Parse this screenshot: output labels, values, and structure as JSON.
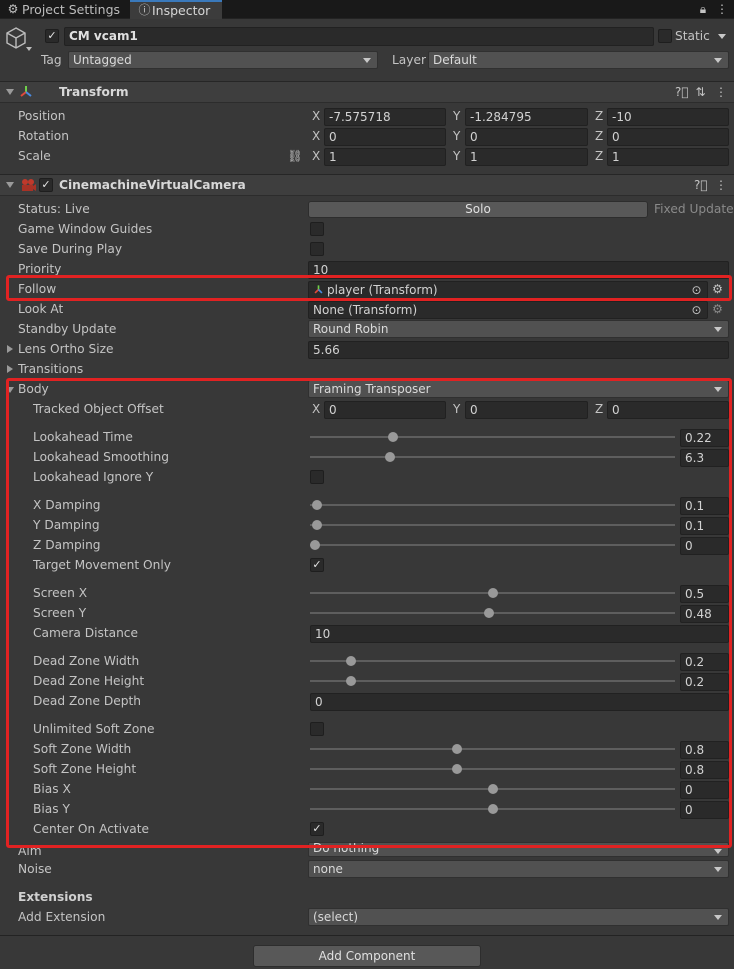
{
  "tabs": {
    "project_settings": "Project Settings",
    "inspector": "Inspector"
  },
  "gameobject": {
    "name": "CM vcam1",
    "static_label": "Static",
    "tag_label": "Tag",
    "tag_value": "Untagged",
    "layer_label": "Layer",
    "layer_value": "Default"
  },
  "transform": {
    "title": "Transform",
    "position_label": "Position",
    "rotation_label": "Rotation",
    "scale_label": "Scale",
    "axis_x": "X",
    "axis_y": "Y",
    "axis_z": "Z",
    "position": {
      "x": "-7.575718",
      "y": "-1.284795",
      "z": "-10"
    },
    "rotation": {
      "x": "0",
      "y": "0",
      "z": "0"
    },
    "scale": {
      "x": "1",
      "y": "1",
      "z": "1"
    }
  },
  "vcam": {
    "title": "CinemachineVirtualCamera",
    "status": "Status: Live",
    "solo": "Solo",
    "fixed_update": "Fixed Update",
    "game_window_guides": "Game Window Guides",
    "save_during_play": "Save During Play",
    "priority_label": "Priority",
    "priority_value": "10",
    "follow_label": "Follow",
    "follow_value": "player (Transform)",
    "look_at_label": "Look At",
    "look_at_value": "None (Transform)",
    "standby_label": "Standby Update",
    "standby_value": "Round Robin",
    "lens_label": "Lens Ortho Size",
    "lens_value": "5.66",
    "transitions_label": "Transitions",
    "body_label": "Body",
    "body_value": "Framing Transposer",
    "aim_label": "Aim",
    "aim_value": "Do nothing",
    "noise_label": "Noise",
    "noise_value": "none",
    "extensions_label": "Extensions",
    "add_extension_label": "Add Extension",
    "add_extension_value": "(select)"
  },
  "body": {
    "tracked_offset_label": "Tracked Object Offset",
    "tracked_offset": {
      "x": "0",
      "y": "0",
      "z": "0"
    },
    "lookahead_time_label": "Lookahead Time",
    "lookahead_time": "0.22",
    "lookahead_smoothing_label": "Lookahead Smoothing",
    "lookahead_smoothing": "6.3",
    "lookahead_ignore_y_label": "Lookahead Ignore Y",
    "x_damping_label": "X Damping",
    "x_damping": "0.1",
    "y_damping_label": "Y Damping",
    "y_damping": "0.1",
    "z_damping_label": "Z Damping",
    "z_damping": "0",
    "target_movement_only_label": "Target Movement Only",
    "screen_x_label": "Screen X",
    "screen_x": "0.5",
    "screen_y_label": "Screen Y",
    "screen_y": "0.48",
    "camera_distance_label": "Camera Distance",
    "camera_distance": "10",
    "dead_zone_width_label": "Dead Zone Width",
    "dead_zone_width": "0.2",
    "dead_zone_height_label": "Dead Zone Height",
    "dead_zone_height": "0.2",
    "dead_zone_depth_label": "Dead Zone Depth",
    "dead_zone_depth": "0",
    "unlimited_soft_zone_label": "Unlimited Soft Zone",
    "soft_zone_width_label": "Soft Zone Width",
    "soft_zone_width": "0.8",
    "soft_zone_height_label": "Soft Zone Height",
    "soft_zone_height": "0.8",
    "bias_x_label": "Bias X",
    "bias_x": "0",
    "bias_y_label": "Bias Y",
    "bias_y": "0",
    "center_on_activate_label": "Center On Activate"
  },
  "add_component": "Add Component",
  "colors": {
    "highlight": "#e12222",
    "accent": "#3a79bb",
    "background": "#383838"
  },
  "icons": [
    "gear-icon",
    "info-icon",
    "lock-icon",
    "menu-icon",
    "cube-icon",
    "transform-icon",
    "camera-icon",
    "help-icon",
    "preset-icon",
    "target-icon",
    "link-icon"
  ]
}
